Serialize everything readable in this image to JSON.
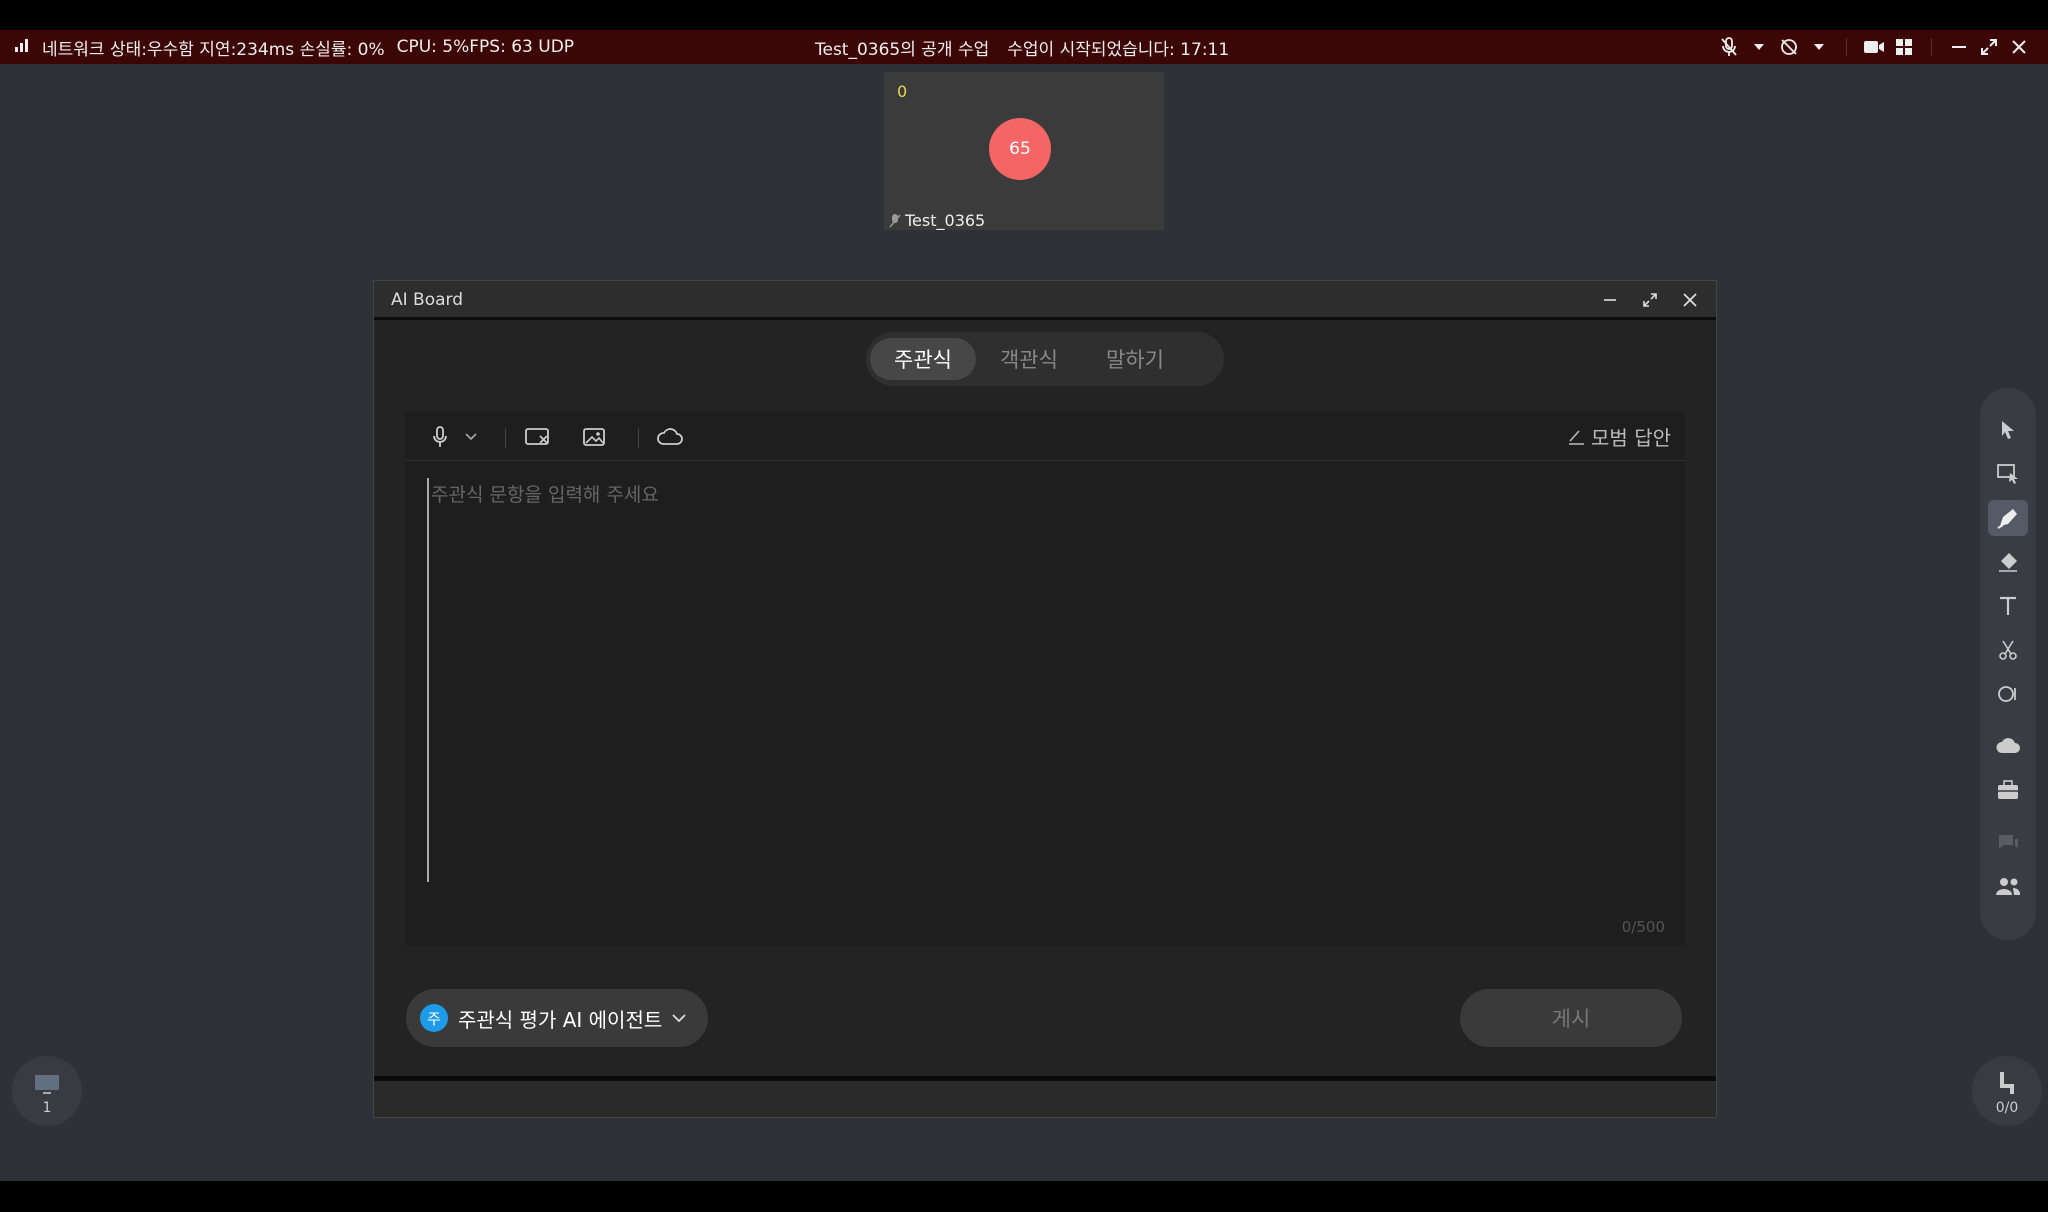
{
  "status_bar": {
    "network": "네트워크 상태:우수함 지연:234ms 손실률: 0%",
    "cpu": "CPU: 5%FPS: 63 UDP",
    "class_title": "Test_0365의 공개 수업",
    "class_status": "수업이 시작되었습니다: 17:11"
  },
  "participant": {
    "count": "0",
    "avatar": "65",
    "name": "Test_0365"
  },
  "ai_board": {
    "title": "AI Board",
    "tabs": [
      {
        "label": "주관식",
        "active": true
      },
      {
        "label": "객관식",
        "active": false
      },
      {
        "label": "말하기",
        "active": false
      }
    ],
    "model_answer": "모범 답안",
    "input": {
      "placeholder": "주관식 문항을 입력해 주세요",
      "value": ""
    },
    "char_count": "0/500",
    "agent": {
      "badge": "주",
      "label": "주관식 평가 AI 에이전트"
    },
    "post_button": "게시"
  },
  "corners": {
    "lecture_count": "1",
    "seat_count": "0/0"
  },
  "colors": {
    "status_bar_bg": "#3d0606",
    "avatar_bg": "#f46565",
    "agent_badge": "#1e9be8",
    "background": "#2f3038"
  }
}
